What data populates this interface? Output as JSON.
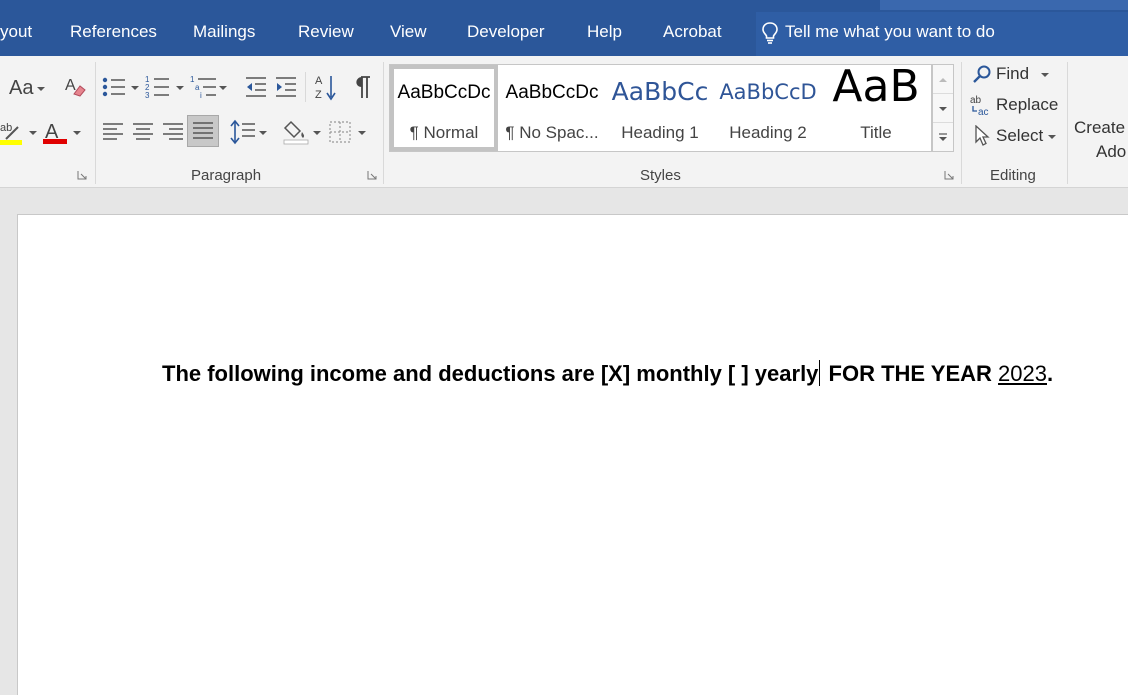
{
  "tabs": [
    "yout",
    "References",
    "Mailings",
    "Review",
    "View",
    "Developer",
    "Help",
    "Acrobat"
  ],
  "tell_me": "Tell me what you want to do",
  "font_group": {
    "change_case": "Aa"
  },
  "paragraph_group": {
    "label": "Paragraph"
  },
  "styles_group": {
    "label": "Styles",
    "items": [
      {
        "preview": "AaBbCcDc",
        "name": "¶ Normal",
        "selected": true
      },
      {
        "preview": "AaBbCcDc",
        "name": "¶ No Spac..."
      },
      {
        "preview": "AaBbCc",
        "name": "Heading 1"
      },
      {
        "preview": "AaBbCcD",
        "name": "Heading 2"
      },
      {
        "preview": "AaB",
        "name": "Title"
      }
    ]
  },
  "editing_group": {
    "label": "Editing",
    "find": "Find",
    "replace": "Replace",
    "select": "Select"
  },
  "create_label": [
    "Create",
    "Ado"
  ],
  "colors": {
    "ribbon_blue": "#2b579a",
    "highlight": "#ffff00",
    "font_color": "#e00000",
    "heading_blue": "#2f5597"
  },
  "document": {
    "text_before": "The following income and deductions are [X] monthly [  ] yearly",
    "text_after": " FOR THE YEAR ",
    "year": "2023",
    "end": "."
  }
}
